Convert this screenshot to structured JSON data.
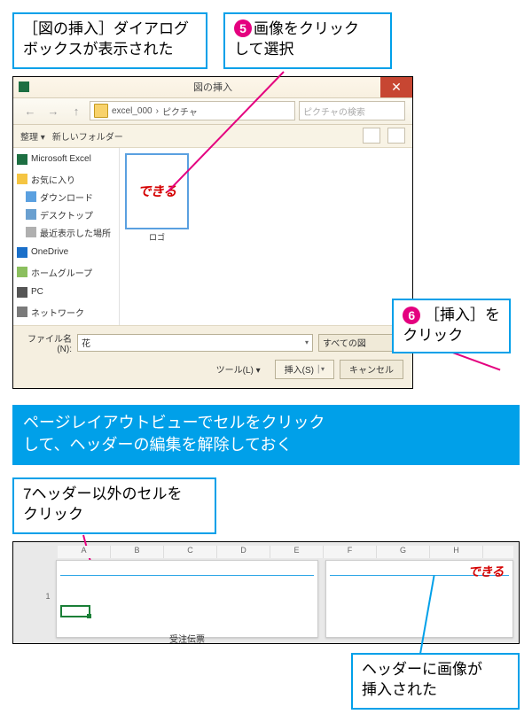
{
  "callouts": {
    "c_top_left_l1": "［図の挿入］ダイアログ",
    "c_top_left_l2": "ボックスが表示された",
    "c5_num": "5",
    "c5_l1": "画像をクリック",
    "c5_l2": "して選択",
    "c6_num": "6",
    "c6_l1": "［挿入］を",
    "c6_l2": "クリック",
    "c7_num": "7",
    "c7_l1": "ヘッダー以外のセルを",
    "c7_l2": "クリック",
    "bar1_l1": "ページレイアウトビューでセルをクリック",
    "bar1_l2": "して、ヘッダーの編集を解除しておく",
    "bottom_l1": "ヘッダーに画像が",
    "bottom_l2": "挿入された"
  },
  "dialog": {
    "title": "図の挿入",
    "back": "←",
    "fwd": "→",
    "up": "↑",
    "crumb_root": "excel_000",
    "crumb_sep": "›",
    "crumb_cur": "ピクチャ",
    "search_placeholder": "ピクチャの検索",
    "organize": "整理 ▾",
    "newfolder": "新しいフォルダー",
    "sidebar": {
      "excel": "Microsoft Excel",
      "fav": "お気に入り",
      "dl": "ダウンロード",
      "desk": "デスクトップ",
      "recent": "最近表示した場所",
      "onedrive": "OneDrive",
      "home": "ホームグループ",
      "pc": "PC",
      "net": "ネットワーク"
    },
    "thumb_text": "できる",
    "thumb_caption": "ロゴ",
    "filename_label": "ファイル名(N):",
    "filename_value": "花",
    "filter": "すべての図",
    "tools": "ツール(L) ▾",
    "insert_btn": "挿入(S)",
    "cancel_btn": "キャンセル"
  },
  "excel": {
    "cols": [
      "A",
      "B",
      "C",
      "D",
      "E",
      "F",
      "G",
      "H"
    ],
    "row": "1",
    "sheet_title": "受注伝票",
    "hdr_logo": "できる"
  }
}
